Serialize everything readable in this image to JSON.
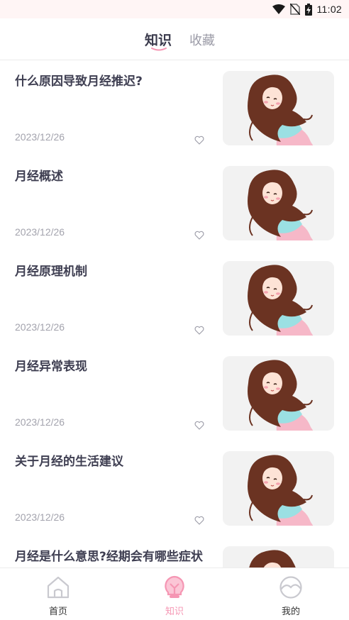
{
  "status_bar": {
    "time": "11:02"
  },
  "header": {
    "tabs": [
      {
        "label": "知识",
        "active": true
      },
      {
        "label": "收藏",
        "active": false
      }
    ]
  },
  "articles": [
    {
      "title": "什么原因导致月经推迟?",
      "date": "2023/12/26",
      "thumbnail": "girl-illustration"
    },
    {
      "title": "月经概述",
      "date": "2023/12/26",
      "thumbnail": "girl-illustration"
    },
    {
      "title": "月经原理机制",
      "date": "2023/12/26",
      "thumbnail": "girl-illustration"
    },
    {
      "title": "月经异常表现",
      "date": "2023/12/26",
      "thumbnail": "girl-illustration"
    },
    {
      "title": "关于月经的生活建议",
      "date": "2023/12/26",
      "thumbnail": "girl-illustration"
    },
    {
      "title": "月经是什么意思?经期会有哪些症状",
      "date": "",
      "thumbnail": "girl-illustration"
    }
  ],
  "bottom_nav": [
    {
      "label": "首页",
      "icon": "home-icon",
      "active": false
    },
    {
      "label": "知识",
      "icon": "lightbulb-icon",
      "active": true
    },
    {
      "label": "我的",
      "icon": "profile-icon",
      "active": false
    }
  ],
  "colors": {
    "accent": "#f596b3",
    "title": "#3f3f52",
    "muted": "#a3a3ad",
    "status_bg": "#fff5f5"
  }
}
